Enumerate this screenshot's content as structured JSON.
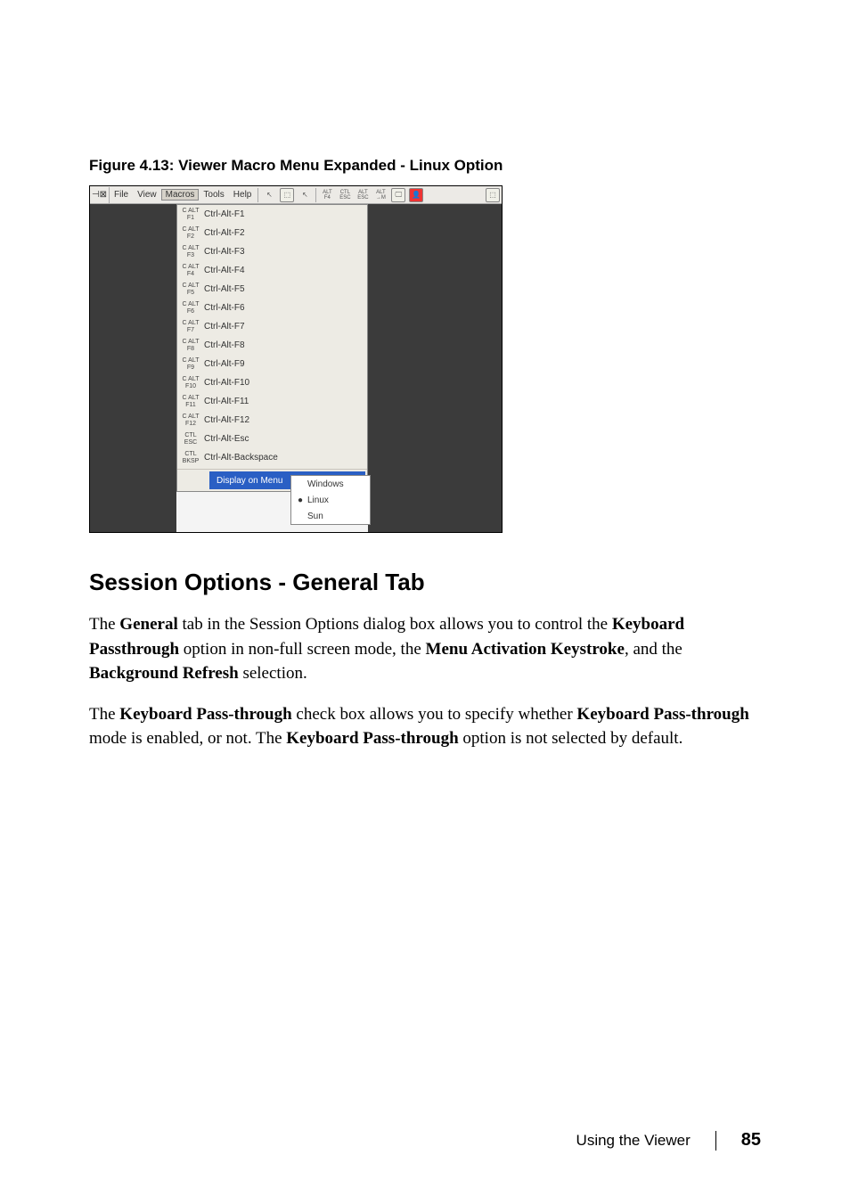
{
  "figure_caption": "Figure 4.13: Viewer Macro Menu Expanded - Linux Option",
  "menubar": {
    "items": [
      "File",
      "View",
      "Macros",
      "Tools",
      "Help"
    ],
    "active_index": 2
  },
  "toolbar_icons": {
    "cursor1": "⬚↖",
    "box1": "⬚",
    "cursor2": "↖",
    "alt_f4": "ALT\nF4",
    "ctl_esc": "CTL\nESC",
    "alt_esc": "ALT\nESC",
    "alt_m": "ALT\n→M",
    "screen": "🖵",
    "person": "👤",
    "dual": "⬚⬚"
  },
  "macro_menu": {
    "items": [
      {
        "icon": "C ALT\nF1",
        "label": "Ctrl-Alt-F1"
      },
      {
        "icon": "C ALT\nF2",
        "label": "Ctrl-Alt-F2"
      },
      {
        "icon": "C ALT\nF3",
        "label": "Ctrl-Alt-F3"
      },
      {
        "icon": "C ALT\nF4",
        "label": "Ctrl-Alt-F4"
      },
      {
        "icon": "C ALT\nF5",
        "label": "Ctrl-Alt-F5"
      },
      {
        "icon": "C ALT\nF6",
        "label": "Ctrl-Alt-F6"
      },
      {
        "icon": "C ALT\nF7",
        "label": "Ctrl-Alt-F7"
      },
      {
        "icon": "C ALT\nF8",
        "label": "Ctrl-Alt-F8"
      },
      {
        "icon": "C ALT\nF9",
        "label": "Ctrl-Alt-F9"
      },
      {
        "icon": "C ALT\nF10",
        "label": "Ctrl-Alt-F10"
      },
      {
        "icon": "C ALT\nF11",
        "label": "Ctrl-Alt-F11"
      },
      {
        "icon": "C ALT\nF12",
        "label": "Ctrl-Alt-F12"
      },
      {
        "icon": "CTL\nESC",
        "label": "Ctrl-Alt-Esc"
      },
      {
        "icon": "CTL\nBKSP",
        "label": "Ctrl-Alt-Backspace"
      }
    ],
    "display_on_menu": "Display on Menu"
  },
  "submenu": {
    "items": [
      {
        "label": "Windows",
        "selected": false
      },
      {
        "label": "Linux",
        "selected": true
      },
      {
        "label": "Sun",
        "selected": false
      }
    ]
  },
  "heading": "Session Options - General Tab",
  "paragraphs": {
    "p1_a": "The ",
    "p1_b": "General",
    "p1_c": " tab in the Session Options dialog box allows you to control the ",
    "p1_d": "Keyboard Passthrough",
    "p1_e": " option in non-full screen mode, the ",
    "p1_f": "Menu Activation Keystroke",
    "p1_g": ", and the ",
    "p1_h": "Background Refresh",
    "p1_i": " selection.",
    "p2_a": "The ",
    "p2_b": "Keyboard Pass-through",
    "p2_c": " check box allows you to specify whether ",
    "p2_d": "Keyboard Pass-through",
    "p2_e": " mode is enabled, or not. The ",
    "p2_f": "Keyboard Pass-through",
    "p2_g": " option is not selected by default."
  },
  "footer": {
    "section": "Using the Viewer",
    "page": "85"
  }
}
